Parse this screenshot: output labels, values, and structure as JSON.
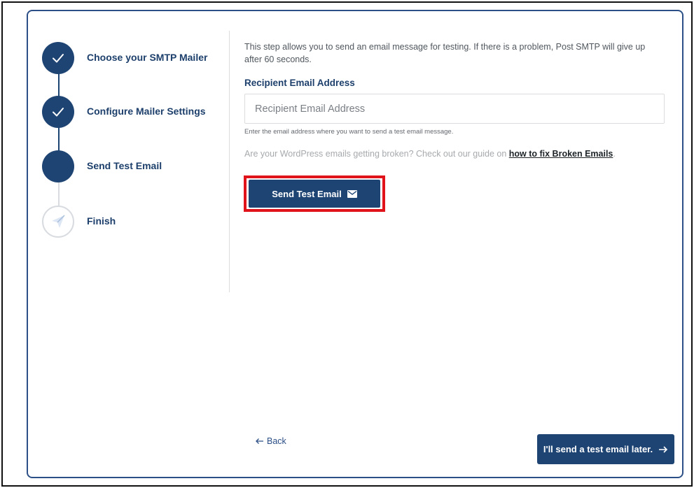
{
  "stepper": {
    "steps": [
      {
        "label": "Choose your SMTP Mailer",
        "status": "completed",
        "icon": "check-icon"
      },
      {
        "label": "Configure Mailer Settings",
        "status": "completed",
        "icon": "check-icon"
      },
      {
        "label": "Send Test Email",
        "status": "current",
        "icon": ""
      },
      {
        "label": "Finish",
        "status": "pending",
        "icon": "paper-plane-icon"
      }
    ]
  },
  "main": {
    "intro": "This step allows you to send an email message for testing. If there is a problem, Post SMTP will give up after 60 seconds.",
    "recipient_label": "Recipient Email Address",
    "recipient_value": "",
    "recipient_placeholder": "Recipient Email Address",
    "recipient_help": "Enter the email address where you want to send a test email message.",
    "guide_prefix": "Are your WordPress emails getting broken? Check out our guide on ",
    "guide_link": "how to fix Broken Emails",
    "guide_suffix": ".",
    "send_button_label": "Send Test Email",
    "send_button_icon": "envelope-icon"
  },
  "footer": {
    "back_label": "Back",
    "back_icon": "arrow-left-icon",
    "later_label": "I'll send a test email later.",
    "later_icon": "arrow-right-icon"
  },
  "colors": {
    "primary": "#1e4473",
    "border": "#2b4f86",
    "highlight": "#e0131b",
    "muted_text": "#a7aaad"
  }
}
